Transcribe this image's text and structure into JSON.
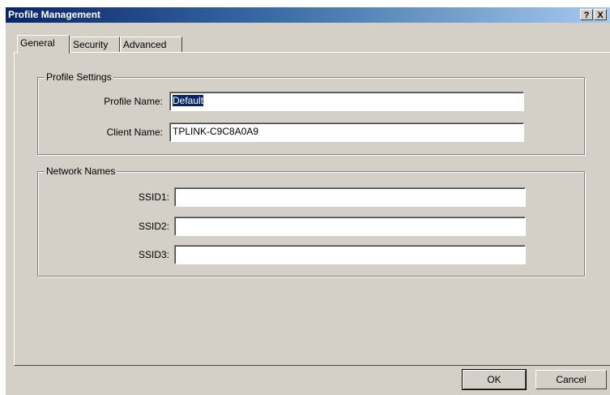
{
  "window": {
    "title": "Profile Management",
    "help_button": "?",
    "close_button": "X"
  },
  "tabs": [
    {
      "label": "General",
      "active": true
    },
    {
      "label": "Security",
      "active": false
    },
    {
      "label": "Advanced",
      "active": false
    }
  ],
  "profile_settings": {
    "group_title": "Profile Settings",
    "profile_name_label": "Profile Name:",
    "profile_name_value": "Default",
    "client_name_label": "Client Name:",
    "client_name_value": "TPLINK-C9C8A0A9"
  },
  "network_names": {
    "group_title": "Network Names",
    "ssid1_label": "SSID1:",
    "ssid1_value": "",
    "ssid2_label": "SSID2:",
    "ssid2_value": "",
    "ssid3_label": "SSID3:",
    "ssid3_value": ""
  },
  "buttons": {
    "ok": "OK",
    "cancel": "Cancel"
  }
}
